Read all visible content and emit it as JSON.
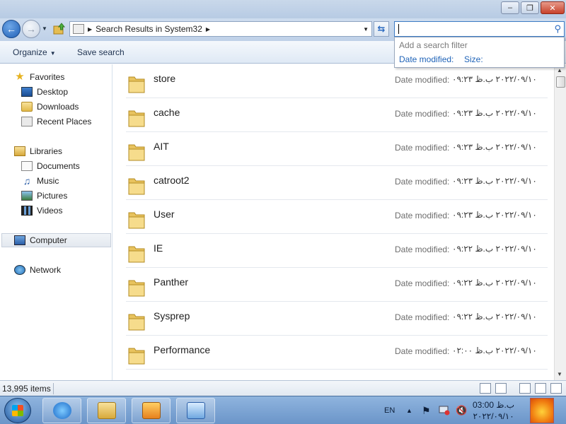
{
  "window": {
    "minimize_label": "–",
    "maximize_label": "❐",
    "close_label": "✕"
  },
  "address_bar": {
    "crumbs": [
      "Search Results in System32"
    ]
  },
  "search": {
    "value": "",
    "filter_hint": "Add a search filter",
    "filter_options": [
      "Date modified:",
      "Size:"
    ]
  },
  "toolbar": {
    "organize_label": "Organize",
    "save_search_label": "Save search"
  },
  "nav_pane": {
    "favorites": {
      "label": "Favorites",
      "items": [
        "Desktop",
        "Downloads",
        "Recent Places"
      ]
    },
    "libraries": {
      "label": "Libraries",
      "items": [
        "Documents",
        "Music",
        "Pictures",
        "Videos"
      ]
    },
    "computer_label": "Computer",
    "network_label": "Network"
  },
  "files": [
    {
      "name": "store",
      "date_label": "Date modified:",
      "date": "۲۰۲۲/۰۹/۱۰ ب.ظ ۰۹:۲۳"
    },
    {
      "name": "cache",
      "date_label": "Date modified:",
      "date": "۲۰۲۲/۰۹/۱۰ ب.ظ ۰۹:۲۳"
    },
    {
      "name": "AIT",
      "date_label": "Date modified:",
      "date": "۲۰۲۲/۰۹/۱۰ ب.ظ ۰۹:۲۳"
    },
    {
      "name": "catroot2",
      "date_label": "Date modified:",
      "date": "۲۰۲۲/۰۹/۱۰ ب.ظ ۰۹:۲۳"
    },
    {
      "name": "User",
      "date_label": "Date modified:",
      "date": "۲۰۲۲/۰۹/۱۰ ب.ظ ۰۹:۲۳"
    },
    {
      "name": "IE",
      "date_label": "Date modified:",
      "date": "۲۰۲۲/۰۹/۱۰ ب.ظ ۰۹:۲۲"
    },
    {
      "name": "Panther",
      "date_label": "Date modified:",
      "date": "۲۰۲۲/۰۹/۱۰ ب.ظ ۰۹:۲۲"
    },
    {
      "name": "Sysprep",
      "date_label": "Date modified:",
      "date": "۲۰۲۲/۰۹/۱۰ ب.ظ ۰۹:۲۲"
    },
    {
      "name": "Performance",
      "date_label": "Date modified:",
      "date": "۲۰۲۲/۰۹/۱۰ ب.ظ ۰۲:۰۰"
    }
  ],
  "status": {
    "item_count": "13,995 items"
  },
  "taskbar": {
    "language": "EN",
    "clock_time": "03:00 ب.ظ",
    "clock_date": "۲۰۲۲/۰۹/۱۰"
  }
}
